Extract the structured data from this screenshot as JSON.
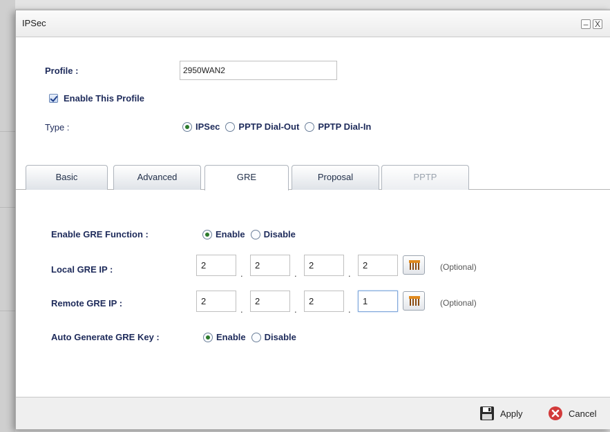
{
  "window": {
    "title": "IPSec",
    "minimize_glyph": "–",
    "close_glyph": "X"
  },
  "profile": {
    "label": "Profile :",
    "value": "2950WAN2"
  },
  "enable_profile": {
    "label": "Enable This Profile",
    "checked": true
  },
  "type": {
    "label": "Type :",
    "options": [
      "IPSec",
      "PPTP Dial-Out",
      "PPTP Dial-In"
    ],
    "selected": "IPSec"
  },
  "tabs": [
    {
      "label": "Basic",
      "state": "normal"
    },
    {
      "label": "Advanced",
      "state": "normal"
    },
    {
      "label": "GRE",
      "state": "active"
    },
    {
      "label": "Proposal",
      "state": "normal"
    },
    {
      "label": "PPTP",
      "state": "disabled"
    }
  ],
  "gre": {
    "enable_function": {
      "label": "Enable GRE Function :",
      "options": [
        "Enable",
        "Disable"
      ],
      "selected": "Enable"
    },
    "local_ip": {
      "label": "Local GRE IP :",
      "octets": [
        "2",
        "2",
        "2",
        "2"
      ],
      "optional": "(Optional)"
    },
    "remote_ip": {
      "label": "Remote GRE IP :",
      "octets": [
        "2",
        "2",
        "2",
        "1"
      ],
      "optional": "(Optional)"
    },
    "auto_key": {
      "label": "Auto Generate GRE Key :",
      "options": [
        "Enable",
        "Disable"
      ],
      "selected": "Enable"
    }
  },
  "footer": {
    "apply_label": "Apply",
    "cancel_label": "Cancel",
    "apply_icon": "save-icon",
    "cancel_icon": "cancel-icon"
  },
  "colors": {
    "label_text": "#1d2a5a",
    "radio_selected": "#2b7a2b",
    "cancel_red": "#d23a3a"
  }
}
